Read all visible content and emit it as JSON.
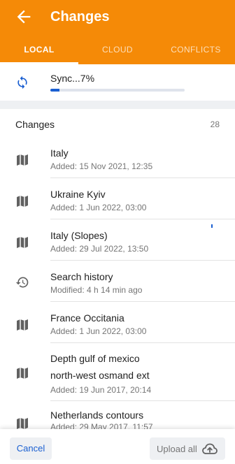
{
  "header": {
    "title": "Changes",
    "back_icon": "arrow-left-icon",
    "color": "#F58A07"
  },
  "tabs": [
    {
      "label": "LOCAL",
      "active": true
    },
    {
      "label": "CLOUD",
      "active": false
    },
    {
      "label": "CONFLICTS",
      "active": false
    }
  ],
  "sync": {
    "icon": "sync-icon",
    "status": "Sync...7%",
    "progress": 0.07,
    "progress_color": "#1a5fd1"
  },
  "changes": {
    "title": "Changes",
    "count": "28",
    "items": [
      {
        "icon": "map-icon",
        "name": "Italy",
        "subtitle": "Added: 15 Nov 2021, 12:35"
      },
      {
        "icon": "map-icon",
        "name": "Ukraine Kyiv",
        "subtitle": "Added: 1 Jun 2022, 03:00"
      },
      {
        "icon": "map-icon",
        "name": "Italy (Slopes)",
        "subtitle": "Added: 29 Jul 2022, 13:50"
      },
      {
        "icon": "history-icon",
        "name": "Search history",
        "subtitle": "Modified: 4 h 14 min ago"
      },
      {
        "icon": "map-icon",
        "name": "France Occitania",
        "subtitle": "Added: 1 Jun 2022, 03:00"
      },
      {
        "icon": "map-icon",
        "name": "Depth gulf of mexico",
        "name_line2": "north-west osmand ext",
        "subtitle": "Added: 19 Jun 2017, 20:14"
      },
      {
        "icon": "map-icon",
        "name": "Netherlands contours",
        "subtitle": "Added: 29 May 2017, 11:57"
      }
    ]
  },
  "footer": {
    "cancel_label": "Cancel",
    "upload_label": "Upload all",
    "upload_icon": "cloud-upload-icon"
  }
}
